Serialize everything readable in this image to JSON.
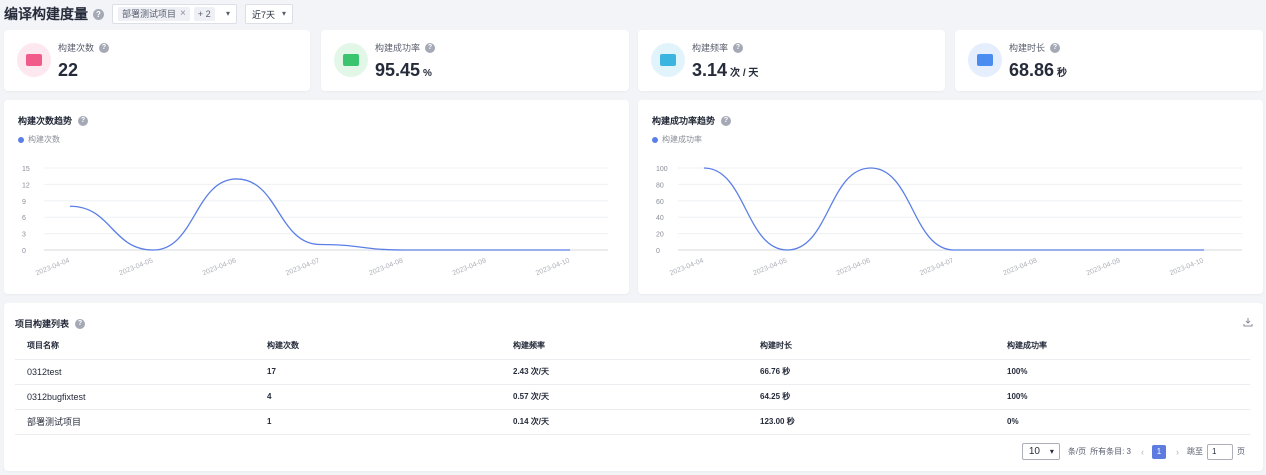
{
  "header": {
    "title": "编译构建度量",
    "project_tag": "部署测试项目",
    "project_more": "+ 2",
    "range": "近7天"
  },
  "kpis": [
    {
      "label": "构建次数",
      "value": "22",
      "unit": "",
      "icon": "build-count-icon",
      "color": "#f05b8a",
      "bg": "#fde8ef"
    },
    {
      "label": "构建成功率",
      "value": "95.45",
      "unit": "%",
      "icon": "success-rate-icon",
      "color": "#3ac46e",
      "bg": "#e3f7e9"
    },
    {
      "label": "构建频率",
      "value": "3.14",
      "unit": "次 / 天",
      "icon": "frequency-icon",
      "color": "#3bb5e0",
      "bg": "#e2f4fb"
    },
    {
      "label": "构建时长",
      "value": "68.86",
      "unit": "秒",
      "icon": "duration-icon",
      "color": "#4a8cf0",
      "bg": "#e5eefc"
    }
  ],
  "charts": {
    "count": {
      "title": "构建次数趋势",
      "legend": "构建次数"
    },
    "rate": {
      "title": "构建成功率趋势",
      "legend": "构建成功率"
    }
  },
  "chart_data": [
    {
      "type": "line",
      "title": "构建次数趋势",
      "categories": [
        "2023-04-04",
        "2023-04-05",
        "2023-04-06",
        "2023-04-07",
        "2023-04-08",
        "2023-04-09",
        "2023-04-10"
      ],
      "series": [
        {
          "name": "构建次数",
          "values": [
            8,
            0,
            13,
            1,
            0,
            0,
            0
          ]
        }
      ],
      "yticks": [
        0,
        3,
        6,
        9,
        12,
        15
      ],
      "ylim": [
        0,
        15
      ],
      "grid": true,
      "legend": "top-left",
      "color": "#5b7fe6"
    },
    {
      "type": "line",
      "title": "构建成功率趋势",
      "categories": [
        "2023-04-04",
        "2023-04-05",
        "2023-04-06",
        "2023-04-07",
        "2023-04-08",
        "2023-04-09",
        "2023-04-10"
      ],
      "series": [
        {
          "name": "构建成功率",
          "values": [
            100,
            0,
            100,
            0,
            0,
            0,
            0
          ]
        }
      ],
      "yticks": [
        0,
        20,
        40,
        60,
        80,
        100
      ],
      "ylim": [
        0,
        100
      ],
      "grid": true,
      "legend": "top-left",
      "color": "#5b7fe6"
    }
  ],
  "table": {
    "title": "项目构建列表",
    "columns": [
      "项目名称",
      "构建次数",
      "构建频率",
      "构建时长",
      "构建成功率"
    ],
    "rows": [
      [
        "0312test",
        "17",
        "2.43 次/天",
        "66.76 秒",
        "100%"
      ],
      [
        "0312bugfixtest",
        "4",
        "0.57 次/天",
        "64.25 秒",
        "100%"
      ],
      [
        "部署测试项目",
        "1",
        "0.14 次/天",
        "123.00 秒",
        "0%"
      ]
    ]
  },
  "pager": {
    "page_size": "10",
    "per_page_label": "条/页",
    "total_label": "所有条目: 3",
    "current_page": "1",
    "jump_label": "跳至",
    "jump_value": "1",
    "page_suffix": "页"
  }
}
